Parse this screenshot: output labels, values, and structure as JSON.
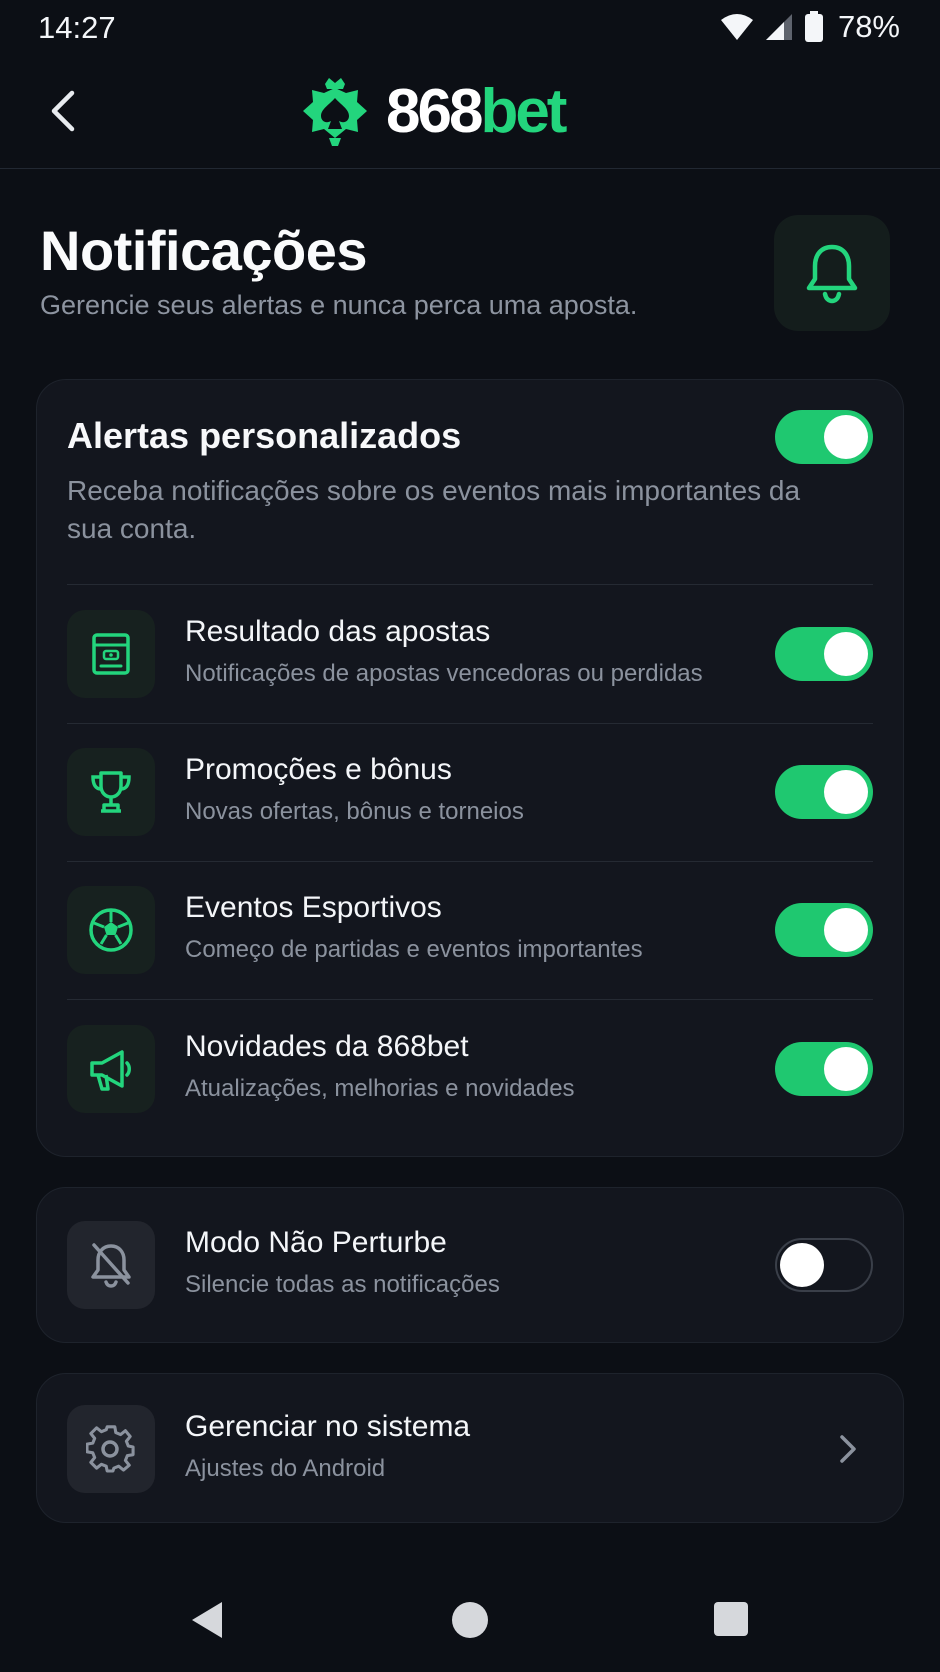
{
  "status_bar": {
    "time": "14:27",
    "battery": "78%"
  },
  "header": {
    "logo_number": "868",
    "logo_word": "bet"
  },
  "page": {
    "title": "Notificações",
    "subtitle": "Gerencie seus alertas e nunca perca uma aposta."
  },
  "alerts": {
    "title": "Alertas personalizados",
    "description": "Receba notificações sobre os eventos mais importantes da sua conta.",
    "enabled": true,
    "items": [
      {
        "icon": "receipt-icon",
        "title": "Resultado das apostas",
        "subtitle": "Notificações de apostas vencedoras ou perdidas",
        "enabled": true
      },
      {
        "icon": "trophy-icon",
        "title": "Promoções e bônus",
        "subtitle": "Novas ofertas, bônus e torneios",
        "enabled": true
      },
      {
        "icon": "soccer-ball-icon",
        "title": "Eventos Esportivos",
        "subtitle": "Começo de partidas e eventos importantes",
        "enabled": true
      },
      {
        "icon": "megaphone-icon",
        "title": "Novidades da 868bet",
        "subtitle": "Atualizações, melhorias e novidades",
        "enabled": true
      }
    ]
  },
  "dnd": {
    "icon": "bell-off-icon",
    "title": "Modo Não Perturbe",
    "subtitle": "Silencie todas as notificações",
    "enabled": false
  },
  "system": {
    "icon": "gear-icon",
    "title": "Gerenciar no sistema",
    "subtitle": "Ajustes do Android"
  },
  "colors": {
    "accent": "#1fc870",
    "background": "#0c0f15",
    "card": "#13161e",
    "muted_text": "#8b929e"
  }
}
